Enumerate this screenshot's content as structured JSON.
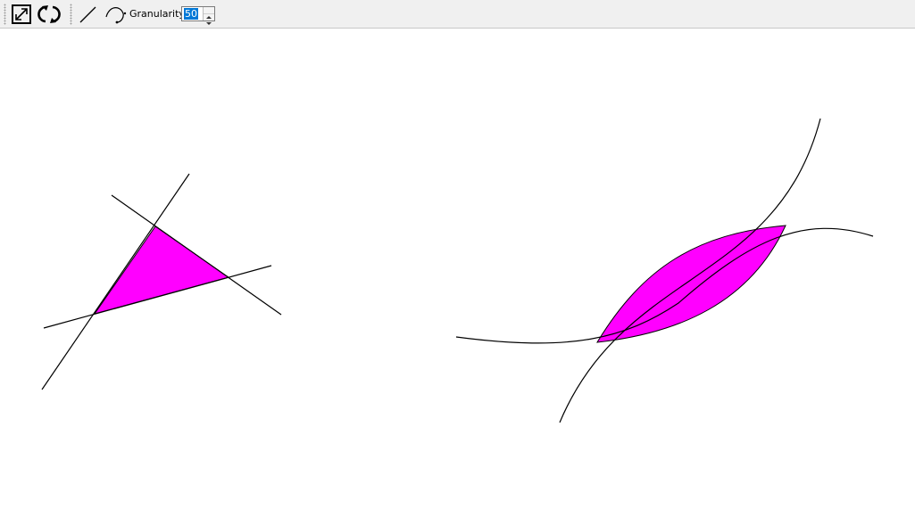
{
  "toolbar": {
    "icons": [
      "fit-view-icon",
      "reset-rotate-icon",
      "line-tool-icon",
      "curve-tool-icon"
    ],
    "granularity_label": "Granularity:",
    "granularity_value": "50"
  },
  "colors": {
    "fill": "#ff00ff",
    "stroke": "#000000",
    "toolbar_bg": "#f0f0f0",
    "selection": "#0078d7"
  }
}
